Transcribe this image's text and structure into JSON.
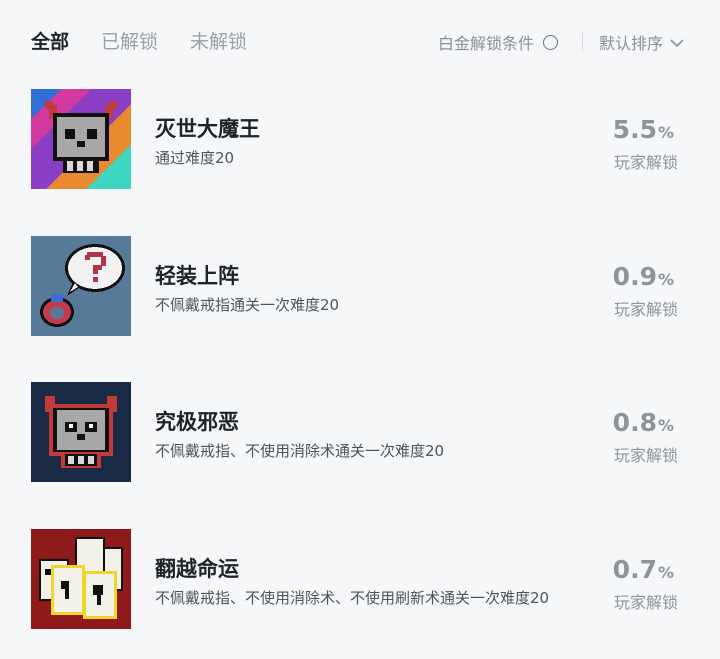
{
  "tabs": [
    {
      "label": "全部",
      "active": true
    },
    {
      "label": "已解锁",
      "active": false
    },
    {
      "label": "未解锁",
      "active": false
    }
  ],
  "filter": {
    "platinum_label": "白金解锁条件",
    "platinum_checked": false
  },
  "sort": {
    "label": "默认排序"
  },
  "colors": {
    "accent_text": "#1f2329",
    "muted": "#8e949c",
    "background": "#f6f7f9"
  },
  "achievements": [
    {
      "title": "灭世大魔王",
      "description": "通过难度20",
      "percent_value": "5.5",
      "percent_unit": "%",
      "percent_label": "玩家解锁",
      "icon": "demon-skull-icon"
    },
    {
      "title": "轻装上阵",
      "description": "不佩戴戒指通关一次难度20",
      "percent_value": "0.9",
      "percent_unit": "%",
      "percent_label": "玩家解锁",
      "icon": "ring-question-icon"
    },
    {
      "title": "究极邪恶",
      "description": "不佩戴戒指、不使用消除术通关一次难度20",
      "percent_value": "0.8",
      "percent_unit": "%",
      "percent_label": "玩家解锁",
      "icon": "evil-skull-icon"
    },
    {
      "title": "翻越命运",
      "description": "不佩戴戒指、不使用消除术、不使用刷新术通关一次难度20",
      "percent_value": "0.7",
      "percent_unit": "%",
      "percent_label": "玩家解锁",
      "icon": "cards-icon"
    }
  ]
}
